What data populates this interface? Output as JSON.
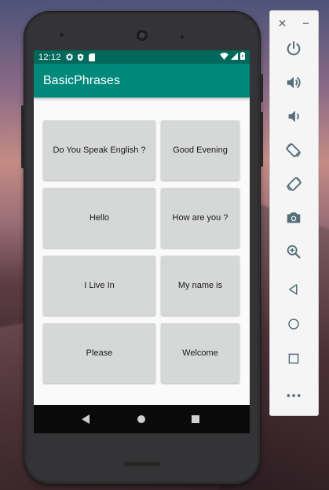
{
  "status_bar": {
    "time": "12:12",
    "left_icons": [
      "gear-icon",
      "shield-icon",
      "sdcard-icon"
    ],
    "right_icons": [
      "wifi-icon",
      "signal-icon",
      "battery-icon"
    ]
  },
  "app_bar": {
    "title": "BasicPhrases"
  },
  "phrases": [
    "Do You Speak English ?",
    "Good Evening",
    "Hello",
    "How are you ?",
    "I Live In",
    "My name is",
    "Please",
    "Welcome"
  ],
  "nav_bar": [
    "back",
    "home",
    "recents"
  ],
  "emulator_toolbar": {
    "window_controls": [
      "close-icon",
      "minimize-icon"
    ],
    "buttons": [
      "power",
      "volume-up",
      "volume-down",
      "rotate-left",
      "rotate-right",
      "screenshot",
      "zoom",
      "back",
      "home",
      "overview",
      "more"
    ]
  },
  "colors": {
    "status_bar": "#00695c",
    "app_bar": "#00897b",
    "button": "#d6d7d7"
  }
}
